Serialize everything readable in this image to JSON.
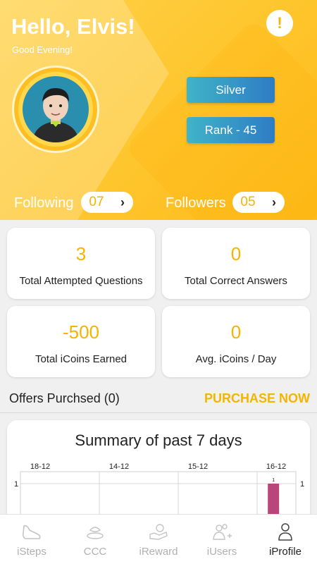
{
  "header": {
    "greeting": "Hello, Elvis!",
    "subtitle": "Good Evening!",
    "alert_icon": "!"
  },
  "profile": {
    "avatar": "user-avatar",
    "tier": "Silver",
    "rank": "Rank - 45",
    "following_label": "Following",
    "following_count": "07",
    "followers_label": "Followers",
    "followers_count": "05"
  },
  "stats": [
    {
      "value": "3",
      "label": "Total Attempted Questions"
    },
    {
      "value": "0",
      "label": "Total Correct Answers"
    },
    {
      "value": "-500",
      "label": "Total iCoins Earned"
    },
    {
      "value": "0",
      "label": "Avg. iCoins / Day"
    }
  ],
  "offers": {
    "label": "Offers Purchsed (0)",
    "action": "PURCHASE NOW"
  },
  "summary": {
    "title": "Summary of past 7 days"
  },
  "chart_data": {
    "type": "bar",
    "title": "Summary of past 7 days",
    "x_ticks": [
      "18-12",
      "14-12",
      "15-12",
      "16-12"
    ],
    "y_ticks_left": [
      "1"
    ],
    "y_ticks_right": [
      "1"
    ],
    "bars": [
      {
        "position": 3.8,
        "value": 1,
        "label": "1"
      }
    ],
    "ylim": [
      0,
      1
    ],
    "bar_color": "#b8467a"
  },
  "nav": [
    {
      "label": "iSteps",
      "icon": "steps-icon"
    },
    {
      "label": "CCC",
      "icon": "ccc-icon"
    },
    {
      "label": "iReward",
      "icon": "reward-icon"
    },
    {
      "label": "iUsers",
      "icon": "users-icon"
    },
    {
      "label": "iProfile",
      "icon": "profile-icon"
    }
  ],
  "colors": {
    "accent": "#f4b400",
    "header": "#fec42a",
    "badge_start": "#40b4c8",
    "badge_end": "#2e7cc4"
  }
}
